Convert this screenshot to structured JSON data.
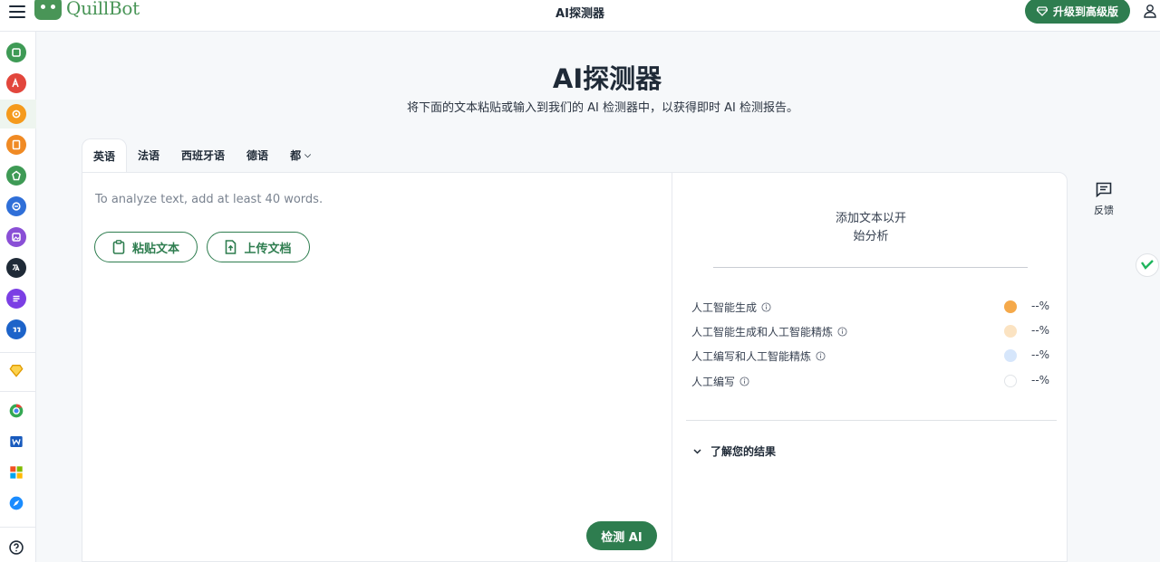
{
  "topbar": {
    "logo_text": "QuillBot",
    "title": "AI探测器",
    "upgrade_label": "升级到高级版"
  },
  "sidebar": {
    "items": [
      {
        "icon": "paraphraser-icon",
        "color": "#3e9a55"
      },
      {
        "icon": "grammar-checker-icon",
        "color": "#e2463c"
      },
      {
        "icon": "ai-detector-icon",
        "color": "#f59a1c"
      },
      {
        "icon": "plagiarism-checker-icon",
        "color": "#f08a24"
      },
      {
        "icon": "ai-humanizer-icon",
        "color": "#3e9a55"
      },
      {
        "icon": "chat-icon",
        "color": "#2f6fd8"
      },
      {
        "icon": "ai-image-icon",
        "color": "#8a4fd6"
      },
      {
        "icon": "translator-icon",
        "color": "#1f2a37"
      },
      {
        "icon": "summarizer-icon",
        "color": "#7b3fe4"
      },
      {
        "icon": "citation-generator-icon",
        "color": "#1d63c9"
      },
      {
        "icon": "premium-diamond-icon",
        "color": "#f5b400"
      },
      {
        "icon": "chrome-extension-icon",
        "color": "#ea4335"
      },
      {
        "icon": "word-addin-icon",
        "color": "#185abd"
      },
      {
        "icon": "windows-app-icon",
        "color": "#00a4ef"
      },
      {
        "icon": "safari-extension-icon",
        "color": "#1a8cff"
      },
      {
        "icon": "help-icon",
        "color": "#1f2a37"
      }
    ]
  },
  "header": {
    "title": "AI探测器",
    "subtitle": "将下面的文本粘贴或输入到我们的 AI 检测器中，以获得即时 AI 检测报告。"
  },
  "tabs": [
    {
      "label": "英语",
      "active": true
    },
    {
      "label": "法语"
    },
    {
      "label": "西班牙语"
    },
    {
      "label": "德语"
    },
    {
      "label": "都"
    }
  ],
  "editor": {
    "placeholder": "To analyze text, add at least 40 words.",
    "paste_label": "粘贴文本",
    "upload_label": "上传文档",
    "detect_label": "检测 AI"
  },
  "results": {
    "hint": "添加文本以开始分析",
    "hint_line1": "添加文本以开",
    "hint_line2": "始分析",
    "legend": [
      {
        "label": "人工智能生成",
        "value": "--%",
        "color": "#f5a94a"
      },
      {
        "label": "人工智能生成和人工智能精炼",
        "value": "--%",
        "color": "#fbe3c2"
      },
      {
        "label": "人工编写和人工智能精炼",
        "value": "--%",
        "color": "#d6e6fb"
      },
      {
        "label": "人工编写",
        "value": "--%",
        "color": "#ffffff"
      }
    ],
    "learn_label": "了解您的结果"
  },
  "feedback": {
    "label": "反馈"
  },
  "colors": {
    "brand": "#499557",
    "primary_button": "#2e7d4f"
  }
}
